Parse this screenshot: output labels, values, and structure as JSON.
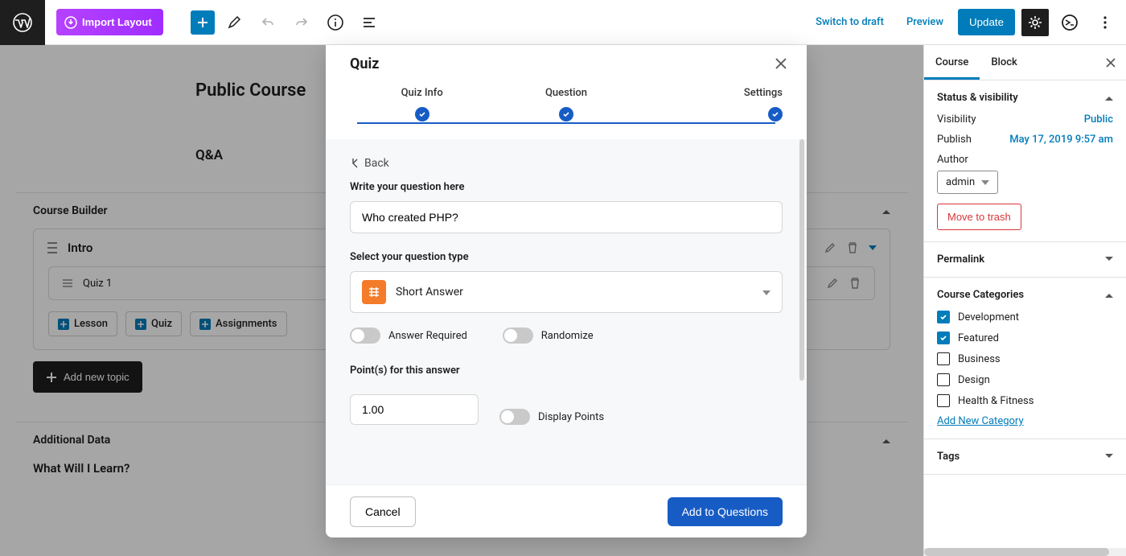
{
  "topbar": {
    "import_label": "Import Layout",
    "switch_draft": "Switch to draft",
    "preview": "Preview",
    "update": "Update"
  },
  "editor": {
    "course_title": "Public Course",
    "qa_title": "Q&A",
    "course_builder": "Course Builder",
    "topic": {
      "title": "Intro",
      "quiz": "Quiz 1"
    },
    "chips": {
      "lesson": "Lesson",
      "quiz": "Quiz",
      "assignments": "Assignments"
    },
    "add_topic": "Add new topic",
    "additional_data": "Additional Data",
    "what_learn": "What Will I Learn?"
  },
  "modal": {
    "title": "Quiz",
    "steps": {
      "info": "Quiz Info",
      "question": "Question",
      "settings": "Settings"
    },
    "back": "Back",
    "question_label": "Write your question here",
    "question_value": "Who created PHP?",
    "type_label": "Select your question type",
    "type_value": "Short Answer",
    "answer_required": "Answer Required",
    "randomize": "Randomize",
    "points_label": "Point(s) for this answer",
    "points_value": "1.00",
    "display_points": "Display Points",
    "cancel": "Cancel",
    "add_to_questions": "Add to Questions"
  },
  "sidebar": {
    "tabs": {
      "course": "Course",
      "block": "Block"
    },
    "status": {
      "title": "Status & visibility",
      "visibility_k": "Visibility",
      "visibility_v": "Public",
      "publish_k": "Publish",
      "publish_v": "May 17, 2019 9:57 am",
      "author_k": "Author",
      "author_v": "admin",
      "trash": "Move to trash"
    },
    "permalink": "Permalink",
    "categories": {
      "title": "Course Categories",
      "items": [
        "Development",
        "Featured",
        "Business",
        "Design",
        "Health & Fitness"
      ],
      "checked": [
        true,
        true,
        false,
        false,
        false
      ],
      "add": "Add New Category"
    },
    "tags": "Tags"
  }
}
